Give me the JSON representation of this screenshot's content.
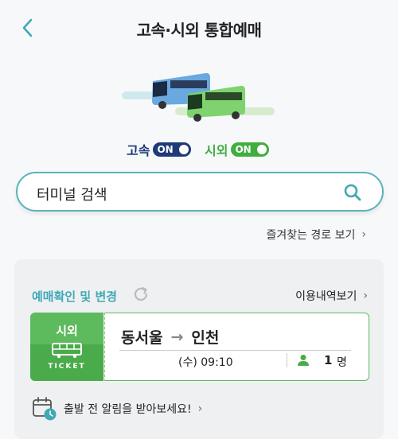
{
  "header": {
    "title": "고속·시외 통합예매"
  },
  "toggles": [
    {
      "label": "고속",
      "state": "ON",
      "color": "#1e3a78"
    },
    {
      "label": "시외",
      "state": "ON",
      "color": "#3fae3f"
    }
  ],
  "search": {
    "text": "터미널 검색",
    "icon": "search-icon"
  },
  "favorites": {
    "label": "즐겨찾는 경로 보기",
    "chevron": "›"
  },
  "reservation": {
    "title": "예매확인 및 변경",
    "history_label": "이용내역보기",
    "chevron": "›",
    "ticket": {
      "type": "시외",
      "ticket_text": "TICKET",
      "origin": "동서울",
      "arrow": "→",
      "destination": "인천",
      "datetime": "(수) 09:10",
      "passenger_count": "1",
      "passenger_unit": "명"
    }
  },
  "alarm": {
    "text": "출발 전 알림을 받아보세요!",
    "chevron": "›"
  },
  "colors": {
    "accent": "#3fa9b5",
    "express": "#1e3a78",
    "intercity": "#3fae3f"
  }
}
